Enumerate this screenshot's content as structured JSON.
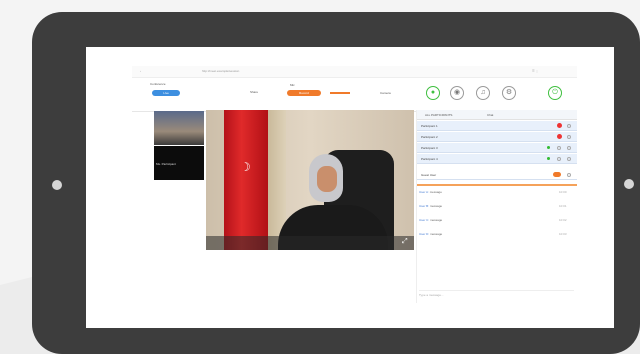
{
  "topbar": {
    "left": "‹",
    "center": "http://meet.example/session",
    "right": "☰ ⋮"
  },
  "toolbar": {
    "brand": "Conference",
    "live_label": "Live",
    "share_label": "Share",
    "mic_label": "Mic",
    "camera_label": "Camera",
    "record_label": "Record",
    "speaker_label": "Speaker",
    "exit_label": "Exit"
  },
  "thumbnails": {
    "second_name": "Ms. Participant"
  },
  "panel": {
    "header": "ALL PARTICIPANTS",
    "tab": "Chat",
    "participants": [
      "Participant 1",
      "Participant 2",
      "Participant 3",
      "Participant 4"
    ],
    "self_row": "Guest User",
    "chat": [
      {
        "who": "User A:",
        "text": "message",
        "time": "10:00"
      },
      {
        "who": "User B:",
        "text": "message",
        "time": "10:01"
      },
      {
        "who": "User C:",
        "text": "message",
        "time": "10:02"
      },
      {
        "who": "User D:",
        "text": "message",
        "time": "10:03"
      }
    ],
    "input_placeholder": "Type a message..."
  },
  "colors": {
    "accent_blue": "#3d8fe0",
    "accent_orange": "#f07a2a",
    "accent_green": "#3fbf3f",
    "tablet_frame": "#3d3d3d"
  },
  "icons": {
    "mic": "mic-icon",
    "camera": "camera-icon",
    "speaker": "speaker-icon",
    "settings": "gear-icon",
    "exit": "power-icon",
    "expand": "expand-icon"
  }
}
